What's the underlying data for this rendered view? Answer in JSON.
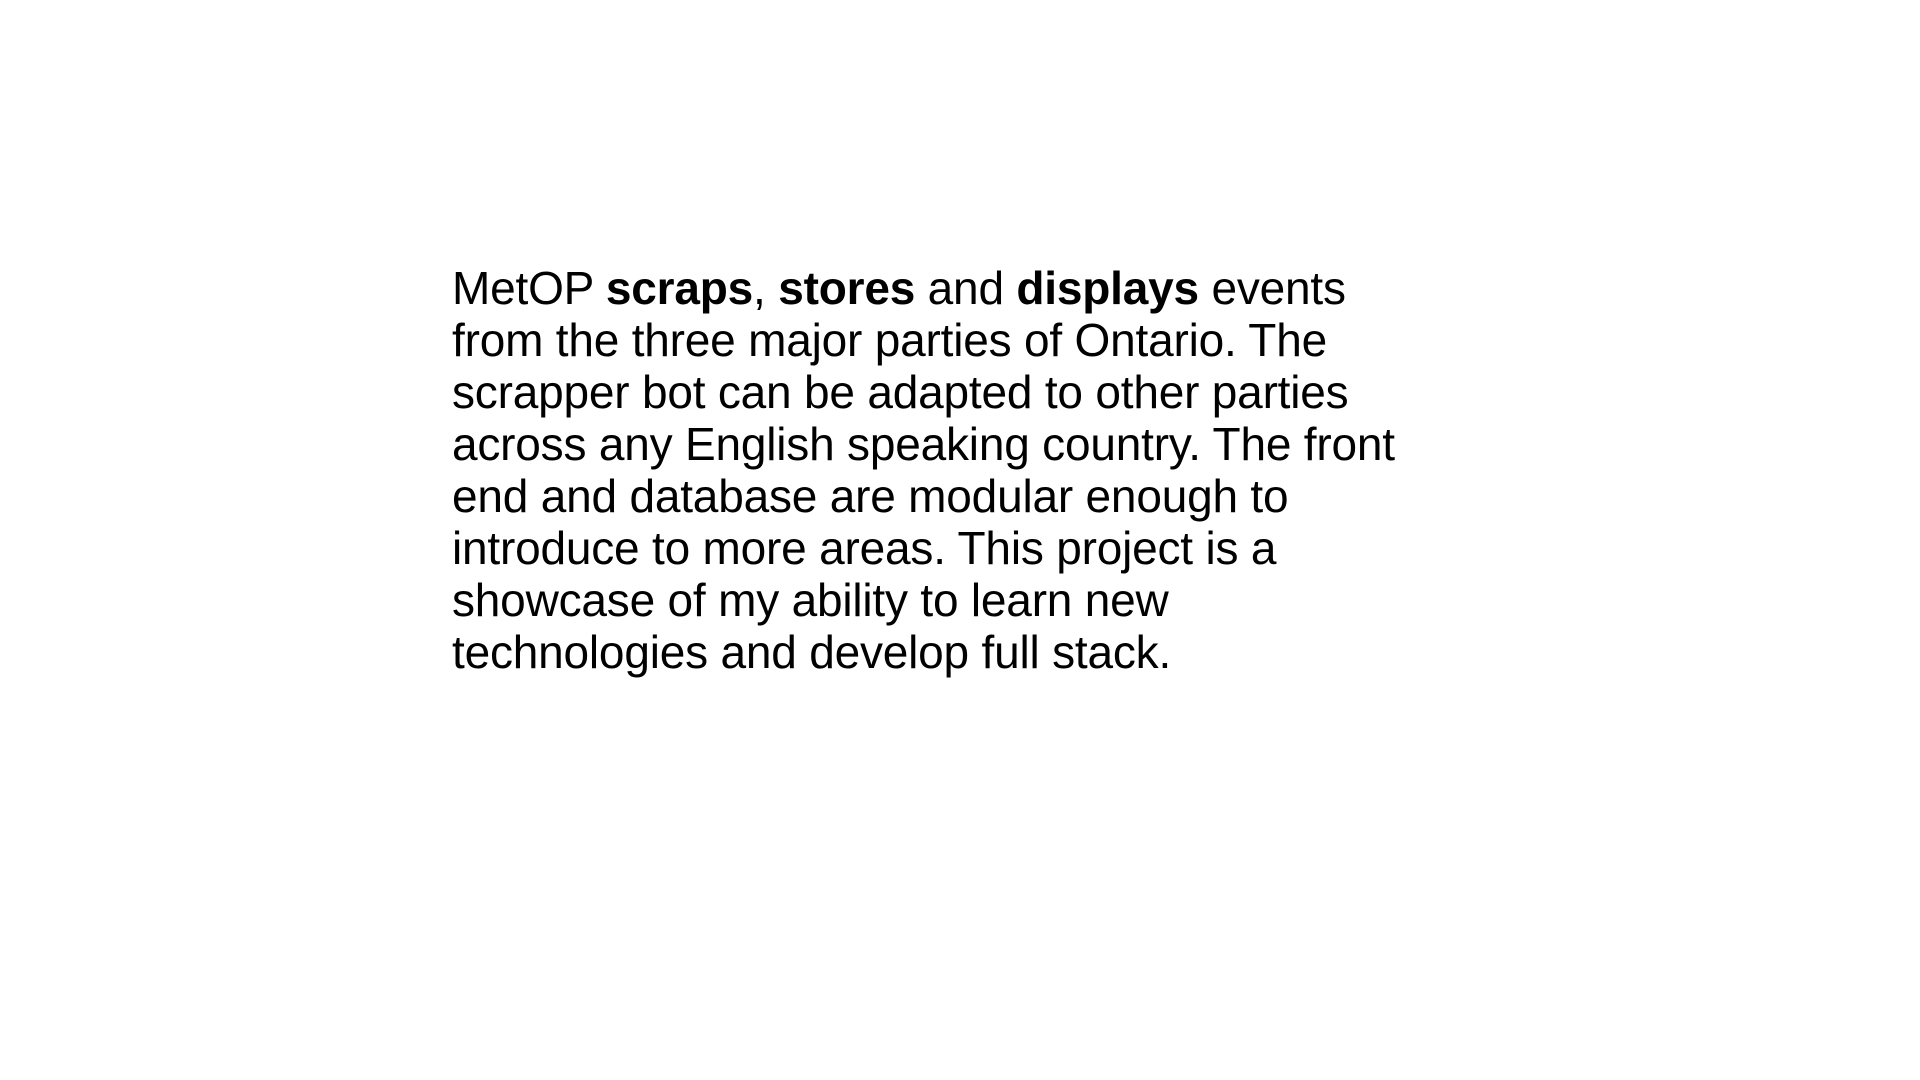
{
  "description": {
    "line1": {
      "prefix": "MetOP ",
      "scraps": "scraps",
      "comma": ", ",
      "stores": "stores",
      "and": " and ",
      "displays": "displays",
      "suffix": " events"
    },
    "line2": "from the three major parties of Ontario. The",
    "line3": "scrapper bot can be adapted to other parties",
    "line4": "across any English speaking country. The front",
    "line5": "end and database are modular enough to",
    "line6": "introduce to more areas. This project is a",
    "line7": "showcase of my ability to learn new",
    "line8": "technologies and develop full stack."
  },
  "colors": {
    "background": "#ffffff",
    "text": "#000000"
  }
}
